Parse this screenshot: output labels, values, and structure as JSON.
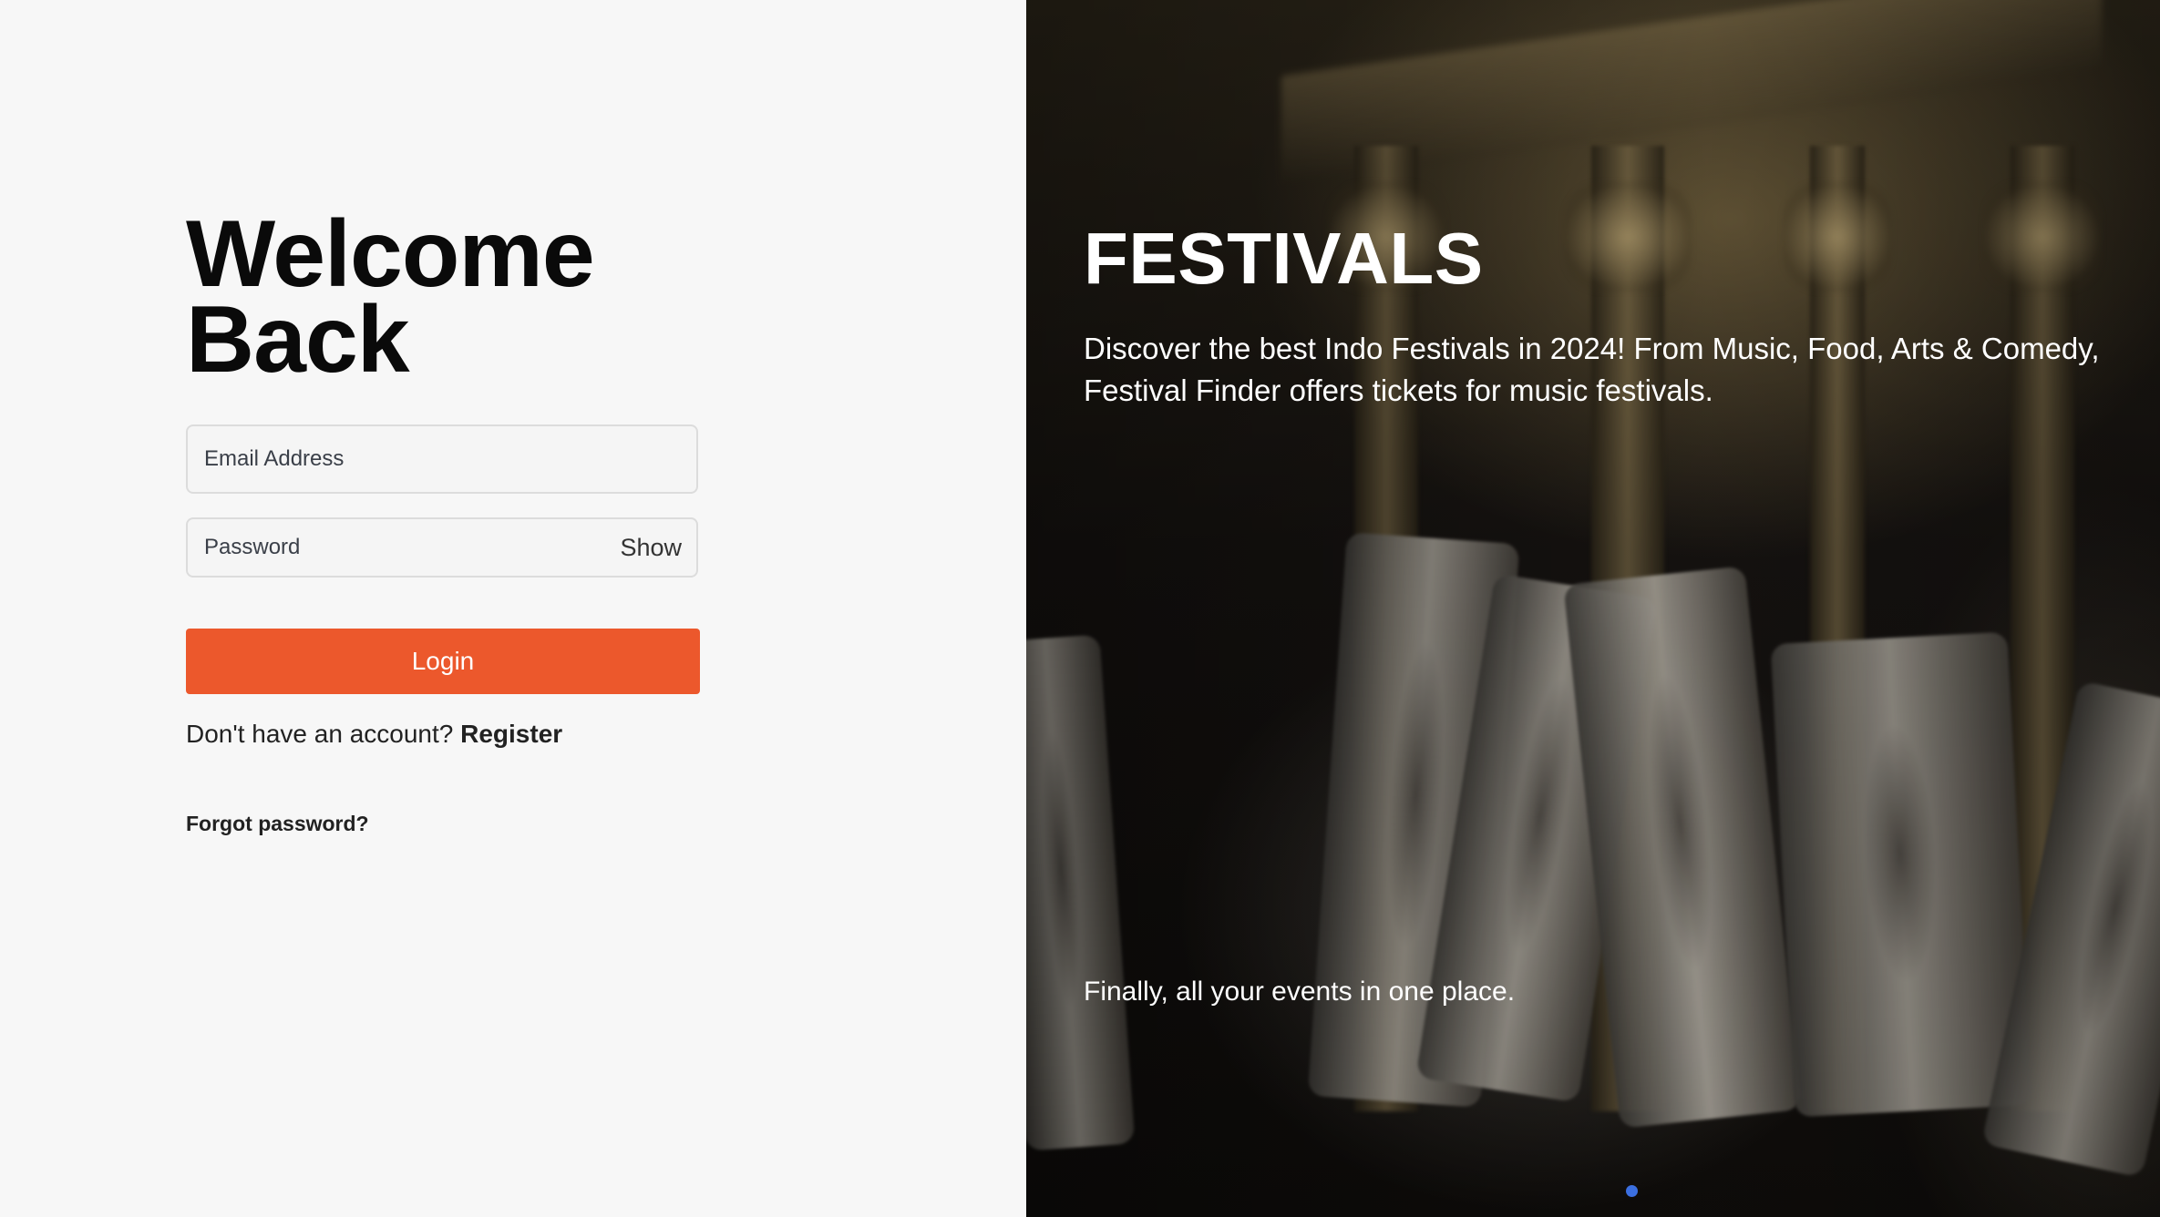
{
  "login": {
    "title_line1": "Welcome",
    "title_line2": "Back",
    "email_placeholder": "Email Address",
    "password_placeholder": "Password",
    "show_label": "Show",
    "login_label": "Login",
    "no_account_text": "Don't have an account?",
    "register_label": "Register",
    "forgot_label": "Forgot password?"
  },
  "hero": {
    "headline": "FESTIVALS",
    "description": "Discover the best Indo Festivals in 2024! From Music, Food, Arts & Comedy, Festival Finder offers tickets for music festivals.",
    "tagline": "Finally, all your events in one place.",
    "active_slide": 1,
    "dot_color": "#3b6fe0"
  },
  "colors": {
    "accent": "#ec582c",
    "left_background": "#f7f7f7"
  }
}
